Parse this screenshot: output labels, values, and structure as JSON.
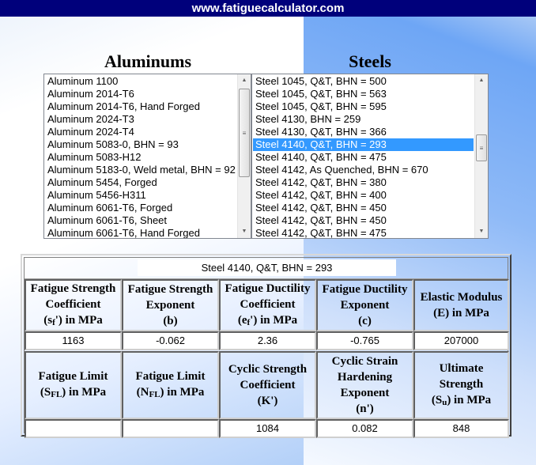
{
  "header": {
    "title": "www.fatiguecalculator.com"
  },
  "aluminums": {
    "heading": "Aluminums",
    "items": [
      "Aluminum 1100",
      "Aluminum 2014-T6",
      "Aluminum 2014-T6, Hand Forged",
      "Aluminum 2024-T3",
      "Aluminum 2024-T4",
      "Aluminum 5083-0, BHN = 93",
      "Aluminum 5083-H12",
      "Aluminum 5183-0, Weld metal, BHN = 92",
      "Aluminum 5454, Forged",
      "Aluminum 5456-H311",
      "Aluminum 6061-T6, Forged",
      "Aluminum 6061-T6, Sheet",
      "Aluminum 6061-T6, Hand Forged"
    ]
  },
  "steels": {
    "heading": "Steels",
    "selected_index": 5,
    "items": [
      "Steel 1045, Q&T, BHN = 500",
      "Steel 1045, Q&T, BHN = 563",
      "Steel 1045, Q&T, BHN = 595",
      "Steel 4130, BHN = 259",
      "Steel 4130, Q&T, BHN = 366",
      "Steel 4140, Q&T, BHN = 293",
      "Steel 4140, Q&T, BHN = 475",
      "Steel 4142, As Quenched, BHN = 670",
      "Steel 4142, Q&T, BHN = 380",
      "Steel 4142, Q&T, BHN = 400",
      "Steel 4142, Q&T, BHN = 450",
      "Steel 4142, Q&T, BHN = 450",
      "Steel 4142, Q&T, BHN = 475"
    ]
  },
  "results": {
    "selected_material": "Steel 4140, Q&T, BHN = 293",
    "row1": [
      {
        "lines": [
          "Fatigue Strength",
          "Coefficient",
          "(sf') in MPa"
        ],
        "value": "1163"
      },
      {
        "lines": [
          "Fatigue Strength",
          "Exponent",
          "(b)"
        ],
        "value": "-0.062"
      },
      {
        "lines": [
          "Fatigue Ductility",
          "Coefficient",
          "(ef') in MPa"
        ],
        "value": "2.36"
      },
      {
        "lines": [
          "Fatigue Ductility",
          "Exponent",
          "(c)"
        ],
        "value": "-0.765"
      },
      {
        "lines": [
          "Elastic Modulus",
          "(E) in MPa"
        ],
        "value": "207000"
      }
    ],
    "row2": [
      {
        "lines": [
          "Fatigue Limit",
          "(SFL) in MPa"
        ],
        "value": ""
      },
      {
        "lines": [
          "Fatigue Limit",
          "(NFL) in MPa"
        ],
        "value": ""
      },
      {
        "lines": [
          "Cyclic Strength",
          "Coefficient",
          "(K')"
        ],
        "value": "1084"
      },
      {
        "lines": [
          "Cyclic Strain",
          "Hardening",
          "Exponent",
          "(n')"
        ],
        "value": "0.082"
      },
      {
        "lines": [
          "Ultimate",
          "Strength",
          "(Su) in MPa"
        ],
        "value": "848"
      }
    ]
  },
  "colors": {
    "header_bg": "#00007b",
    "selection": "#3399ff"
  }
}
